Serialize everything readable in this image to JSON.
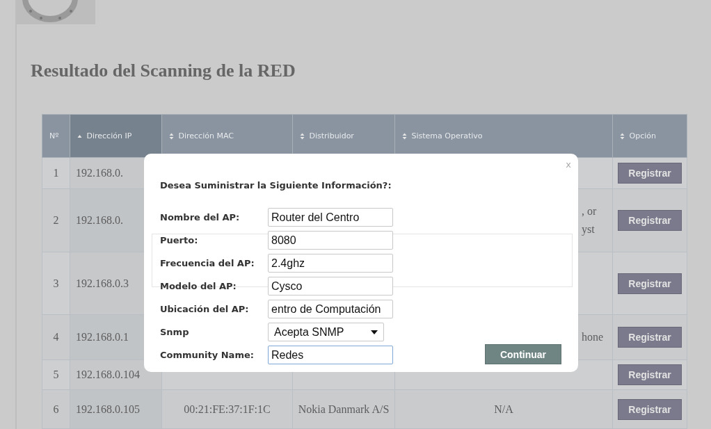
{
  "page": {
    "title": "Resultado del Scanning de la RED"
  },
  "table": {
    "columns": [
      {
        "label": "Nº",
        "sortable": false,
        "sorted": false
      },
      {
        "label": "Dirección IP",
        "sortable": true,
        "sorted": true
      },
      {
        "label": "Dirección MAC",
        "sortable": true,
        "sorted": false
      },
      {
        "label": "Distribuidor",
        "sortable": true,
        "sorted": false
      },
      {
        "label": "Sistema Operativo",
        "sortable": true,
        "sorted": false
      },
      {
        "label": "Opción",
        "sortable": true,
        "sorted": false
      }
    ],
    "rows": [
      {
        "no": "1",
        "ip": "192.168.0.",
        "os_lines": [],
        "action": "Registrar"
      },
      {
        "no": "2",
        "ip": "192.168.0.",
        "os_lines": [
          ", or",
          "yst"
        ],
        "action": "Registrar"
      },
      {
        "no": "3",
        "ip": "192.168.0.3",
        "os_lines": [],
        "action": "Registrar"
      },
      {
        "no": "4",
        "ip": "192.168.0.1",
        "os_lines": [
          "hone"
        ],
        "action": "Registrar"
      },
      {
        "no": "5",
        "ip": "192.168.0.104",
        "os_lines": [],
        "action": "Registrar"
      },
      {
        "no": "6",
        "ip": "192.168.0.105",
        "mac": "00:21:FE:37:1F:1C",
        "vendor": "Nokia Danmark A/S",
        "os_lines": [
          "N/A"
        ],
        "action": "Registrar"
      }
    ]
  },
  "modal": {
    "close": "x",
    "heading": "Desea Suministrar la Siguiente Información?:",
    "fields": [
      {
        "label": "Nombre del AP:",
        "kind": "text",
        "value": "Router del Centro",
        "focused": false
      },
      {
        "label": "Puerto:",
        "kind": "text",
        "value": "8080",
        "focused": false
      },
      {
        "label": "Frecuencia del AP:",
        "kind": "text",
        "value": "2.4ghz",
        "focused": false
      },
      {
        "label": "Modelo del AP:",
        "kind": "text",
        "value": "Cysco",
        "focused": false
      },
      {
        "label": "Ubicación del AP:",
        "kind": "text",
        "value": "entro de Computación",
        "focused": false
      },
      {
        "label": "Snmp",
        "kind": "select",
        "value": "Acepta SNMP",
        "focused": false
      },
      {
        "label": "Community Name:",
        "kind": "text",
        "value": "Redes",
        "focused": true
      }
    ],
    "submit": "Continuar"
  }
}
